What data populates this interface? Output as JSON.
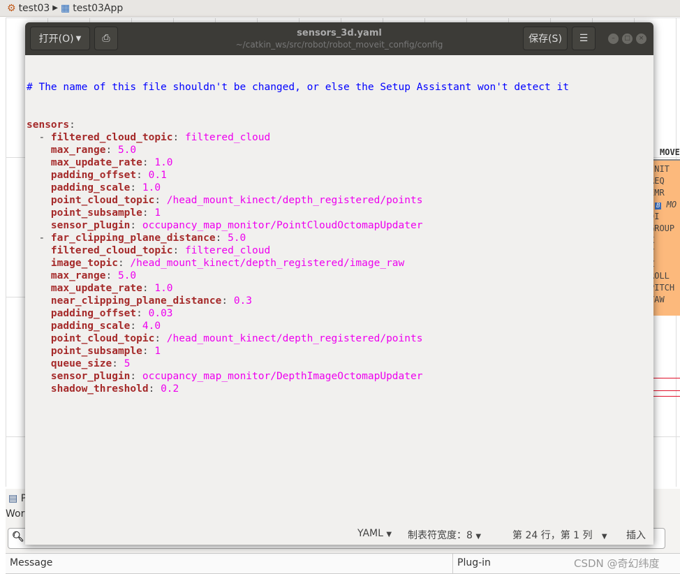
{
  "breadcrumb": {
    "project": "test03",
    "app": "test03App"
  },
  "background_panel": {
    "header": "MOVE",
    "rows": [
      "INIT",
      "REQ",
      "EMR",
      "MO",
      "DI",
      "GROUP",
      "X",
      "Y",
      "Z",
      "ROLL",
      "PITCH",
      "YAW"
    ]
  },
  "bottom_panel": {
    "tab": "P",
    "label": "Wor",
    "col_message": "Message",
    "col_plugin": "Plug-in",
    "watermark": "CSDN @奇幻纬度"
  },
  "editor": {
    "open_label": "打开(O)",
    "save_label": "保存(S)",
    "file_name": "sensors_3d.yaml",
    "file_path": "~/catkin_ws/src/robot/robot_moveit_config/config",
    "comment": "# The name of this file shouldn't be changed, or else the Setup Assistant won't detect it",
    "lines": [
      {
        "prefix": "",
        "key": "sensors",
        "value": ""
      },
      {
        "prefix": "  - ",
        "key": "filtered_cloud_topic",
        "value": "filtered_cloud"
      },
      {
        "prefix": "    ",
        "key": "max_range",
        "value": "5.0"
      },
      {
        "prefix": "    ",
        "key": "max_update_rate",
        "value": "1.0"
      },
      {
        "prefix": "    ",
        "key": "padding_offset",
        "value": "0.1"
      },
      {
        "prefix": "    ",
        "key": "padding_scale",
        "value": "1.0"
      },
      {
        "prefix": "    ",
        "key": "point_cloud_topic",
        "value": "/head_mount_kinect/depth_registered/points"
      },
      {
        "prefix": "    ",
        "key": "point_subsample",
        "value": "1"
      },
      {
        "prefix": "    ",
        "key": "sensor_plugin",
        "value": "occupancy_map_monitor/PointCloudOctomapUpdater"
      },
      {
        "prefix": "  - ",
        "key": "far_clipping_plane_distance",
        "value": "5.0"
      },
      {
        "prefix": "    ",
        "key": "filtered_cloud_topic",
        "value": "filtered_cloud"
      },
      {
        "prefix": "    ",
        "key": "image_topic",
        "value": "/head_mount_kinect/depth_registered/image_raw"
      },
      {
        "prefix": "    ",
        "key": "max_range",
        "value": "5.0"
      },
      {
        "prefix": "    ",
        "key": "max_update_rate",
        "value": "1.0"
      },
      {
        "prefix": "    ",
        "key": "near_clipping_plane_distance",
        "value": "0.3"
      },
      {
        "prefix": "    ",
        "key": "padding_offset",
        "value": "0.03"
      },
      {
        "prefix": "    ",
        "key": "padding_scale",
        "value": "4.0"
      },
      {
        "prefix": "    ",
        "key": "point_cloud_topic",
        "value": "/head_mount_kinect/depth_registered/points"
      },
      {
        "prefix": "    ",
        "key": "point_subsample",
        "value": "1"
      },
      {
        "prefix": "    ",
        "key": "queue_size",
        "value": "5"
      },
      {
        "prefix": "    ",
        "key": "sensor_plugin",
        "value": "occupancy_map_monitor/DepthImageOctomapUpdater"
      },
      {
        "prefix": "    ",
        "key": "shadow_threshold",
        "value": "0.2"
      }
    ],
    "status": {
      "language": "YAML",
      "tab_width": "制表符宽度：8",
      "position": "第 24 行，第 1 列",
      "mode": "插入"
    }
  }
}
